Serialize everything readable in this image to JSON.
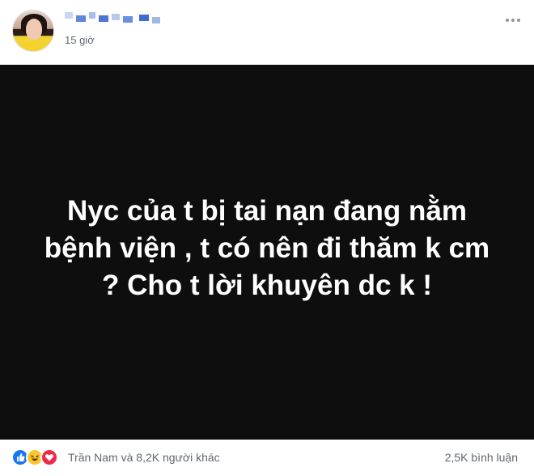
{
  "post": {
    "author": {
      "name_obscured": true,
      "time": "15 giờ"
    },
    "text_post": {
      "text": "Nyc của t bị tai nạn đang nằm bệnh viện , t có nên đi thăm k cm ? Cho t lời khuyên dc k !",
      "background_color": "#0e0e0e",
      "text_color": "#ffffff"
    },
    "footer": {
      "reactions": [
        "like-icon",
        "haha-icon",
        "love-icon"
      ],
      "reactors_label": "Trần Nam và 8,2K người khác",
      "comments_label": "2,5K bình luận"
    }
  },
  "colors": {
    "like": "#1877f2",
    "haha": "#f7c82f",
    "love": "#f0284a",
    "secondary_text": "#616770"
  }
}
